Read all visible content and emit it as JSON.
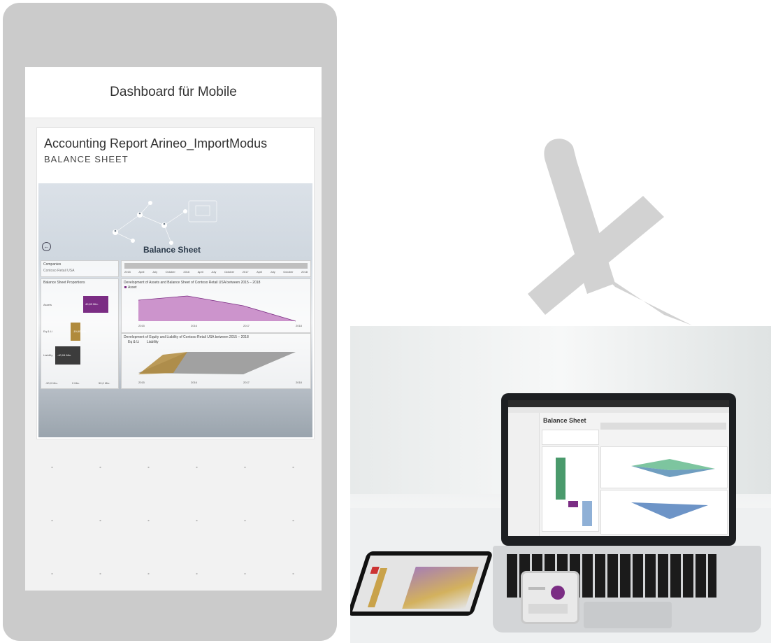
{
  "mobile": {
    "header_title": "Dashboard für Mobile",
    "tile": {
      "title": "Accounting Report Arineo_ImportModus",
      "subtitle": "BALANCE SHEET"
    },
    "report": {
      "title": "Balance Sheet",
      "filter_label": "Companies",
      "filter_value": "Contoso Retail USA",
      "timeline_ticks": [
        "2015",
        "April",
        "July",
        "October",
        "2016",
        "April",
        "July",
        "October",
        "2017",
        "April",
        "July",
        "October",
        "2018"
      ],
      "left_panel_title": "Balance Sheet Proportions",
      "left_bars": [
        {
          "label": "Assets",
          "value": "40,83 Mio.",
          "color": "#7b2d84"
        },
        {
          "label": "Eq & Li",
          "value": "-19,60 Mio.",
          "color": "#b08a3c"
        },
        {
          "label": "Liability",
          "value": "-40,04 Mio.",
          "color": "#3c3c3c"
        }
      ],
      "left_axis": [
        "-50,0 Mio.",
        "0 Mio.",
        "50,0 Mio."
      ],
      "chart1_title": "Development of Assets and Balance Sheet of Contoso Retail USA between 2015 – 2018",
      "chart1_legend": "Asset",
      "chart1_color": "#c07ac0",
      "chart2_title": "Development of Equity and Liability of Contoso Retail USA between 2015 – 2018",
      "chart2_legend": [
        "Eq & Li",
        "Liability"
      ],
      "chart2_colors": [
        "#b08a3c",
        "#8c8c8c"
      ],
      "x_ticks": [
        "2015",
        "2016",
        "2017",
        "2018"
      ]
    }
  },
  "laptop": {
    "report_title": "Balance Sheet"
  }
}
